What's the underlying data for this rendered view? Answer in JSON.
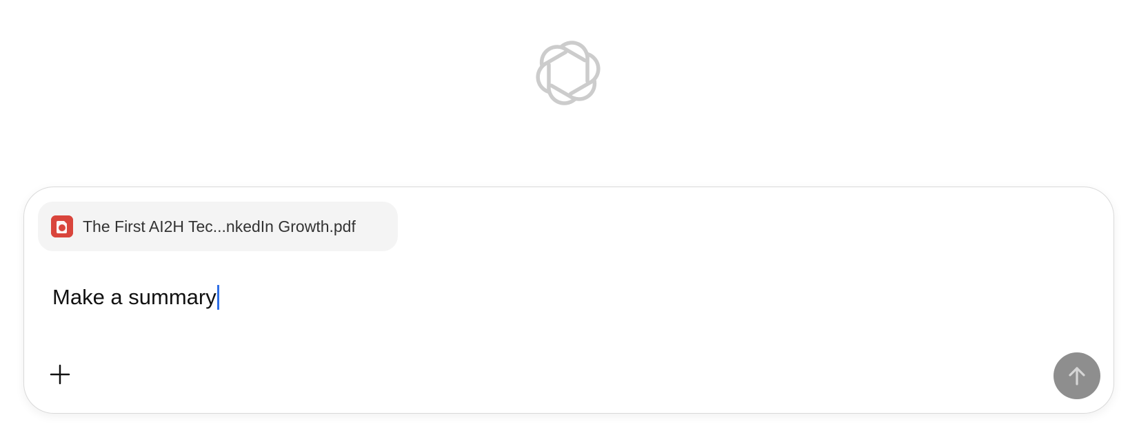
{
  "logo": {
    "icon": "openai-logo-icon",
    "color": "#cccccc"
  },
  "composer": {
    "attachment": {
      "file_name": "The First AI2H Tec...nkedIn Growth.pdf",
      "icon": "pdf-file-icon",
      "icon_color": "#d9453c"
    },
    "message_value": "Make a summary",
    "add_icon": "plus-icon",
    "send_icon": "arrow-up-icon",
    "send_button_color": "#8e8e8e",
    "caret_color": "#2f6fe6"
  }
}
